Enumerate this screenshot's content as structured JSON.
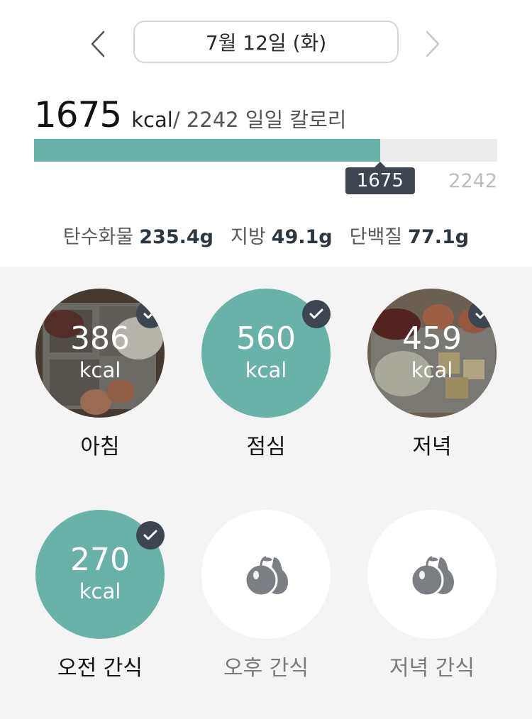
{
  "header": {
    "date_label": "7월 12일 (화)",
    "prev_icon": "chevron-left-icon",
    "next_icon": "chevron-right-icon"
  },
  "calories": {
    "current": "1675",
    "unit": "kcal",
    "rest_text": "/ 2242 일일 칼로리",
    "progress_tip": "1675",
    "goal": "2242",
    "progress_fraction": 0.747
  },
  "macros": [
    {
      "label": "탄수화물",
      "value": "235.4g"
    },
    {
      "label": "지방",
      "value": "49.1g"
    },
    {
      "label": "단백질",
      "value": "77.1g"
    }
  ],
  "meals": [
    {
      "label": "아침",
      "kcal": "386",
      "unit": "kcal",
      "style": "photo",
      "checked": true
    },
    {
      "label": "점심",
      "kcal": "560",
      "unit": "kcal",
      "style": "teal",
      "checked": true
    },
    {
      "label": "저녁",
      "kcal": "459",
      "unit": "kcal",
      "style": "photo",
      "checked": true
    },
    {
      "label": "오전 간식",
      "kcal": "270",
      "unit": "kcal",
      "style": "teal",
      "checked": true
    },
    {
      "label": "오후 간식",
      "style": "empty",
      "icon": "fruit-icon",
      "checked": false
    },
    {
      "label": "저녁 간식",
      "style": "empty",
      "icon": "fruit-icon",
      "checked": false
    }
  ],
  "colors": {
    "accent": "#68b2a8",
    "dark": "#3d4650",
    "track": "#ececec",
    "area": "#f4f4f4"
  }
}
